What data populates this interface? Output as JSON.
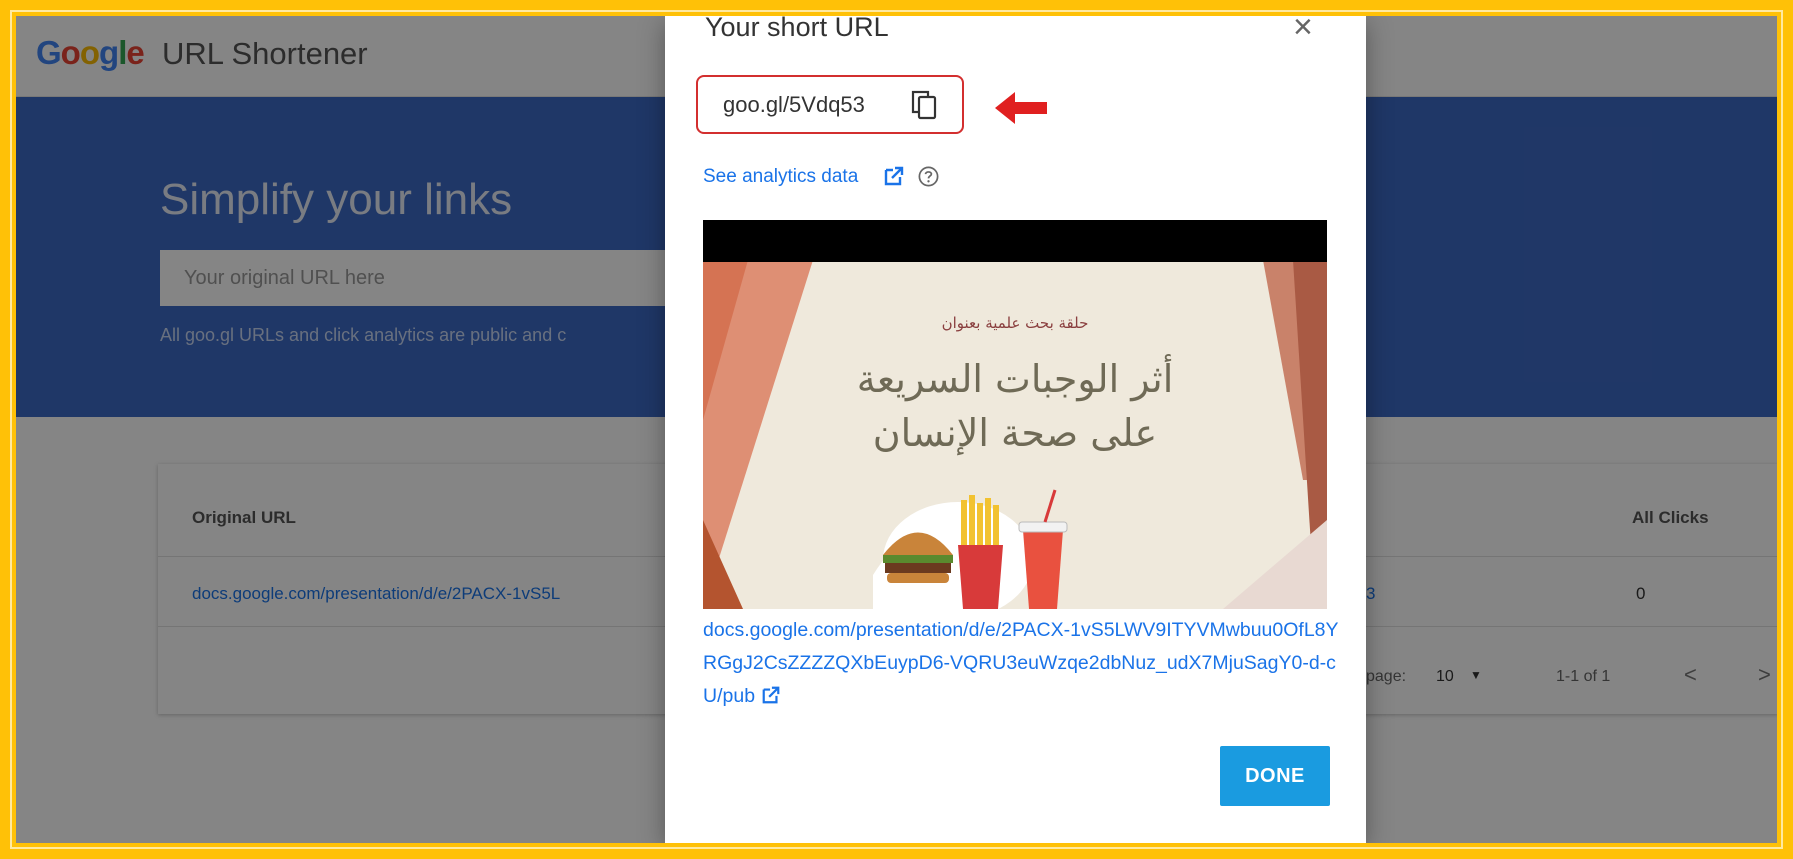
{
  "header": {
    "logo_letters": [
      {
        "ch": "G",
        "color": "#4285f4"
      },
      {
        "ch": "o",
        "color": "#ea4335"
      },
      {
        "ch": "o",
        "color": "#fbbc05"
      },
      {
        "ch": "g",
        "color": "#4285f4"
      },
      {
        "ch": "l",
        "color": "#34a853"
      },
      {
        "ch": "e",
        "color": "#ea4335"
      }
    ],
    "app_name": "URL Shortener"
  },
  "hero": {
    "title": "Simplify your links",
    "input_placeholder": "Your original URL here",
    "note": "All goo.gl URLs and click analytics are public and c"
  },
  "table": {
    "col_original": "Original URL",
    "col_clicks": "All Clicks",
    "rows": [
      {
        "original": "docs.google.com/presentation/d/e/2PACX-1vS5L",
        "short_partial": "3",
        "clicks": "0"
      }
    ],
    "pagination": {
      "rows_label": "page:",
      "rows_value": "10",
      "range": "1-1 of 1",
      "prev": "<",
      "next": ">"
    }
  },
  "modal": {
    "title": "Your short URL",
    "close": "×",
    "short_url": "goo.gl/5Vdq53",
    "analytics_link": "See analytics data",
    "preview": {
      "subtitle": "حلقة بحث علمية بعنوان",
      "line1": "أثر الوجبات السريعة",
      "line2": "على صحة الإنسان"
    },
    "long_url": "docs.google.com/presentation/d/e/2PACX-1vS5LWV9ITYVMwbuu0OfL8YRGgJ2CsZZZZQXbEuypD6-VQRU3euWzqe2dbNuz_udX7MjuSagY0-d-cU/pub",
    "done_label": "DONE"
  },
  "colors": {
    "frame": "#ffc107",
    "hero_blue": "#3d6ac6",
    "link": "#1a73e8",
    "done_button": "#1a9be0",
    "highlight_red": "#d32f2f"
  },
  "icons": [
    "close-icon",
    "copy-icon",
    "red-arrow-icon",
    "external-link-icon",
    "help-icon",
    "chevron-down-icon",
    "chevron-left-icon",
    "chevron-right-icon"
  ]
}
